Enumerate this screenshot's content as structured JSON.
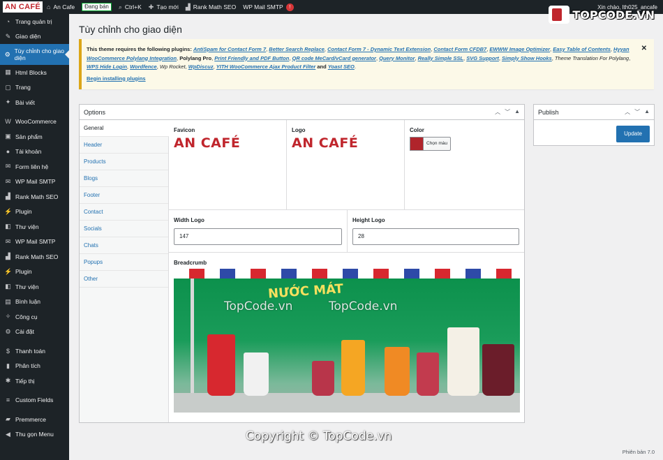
{
  "adminbar": {
    "logo": "AN CAFÉ",
    "site": "An Cafe",
    "status_badge": "Đang bán",
    "search_shortcut": "Ctrl+K",
    "new_label": "Tạo mới",
    "rank_math": "Rank Math SEO",
    "wp_mail": "WP Mail SMTP",
    "mail_count": "!",
    "greeting": "Xin chào, lth025_ancafe"
  },
  "sidebar": {
    "items": [
      {
        "label": "Trang quản trị",
        "icon": "dashboard-icon"
      },
      {
        "label": "Giao diện",
        "icon": "brush-icon"
      },
      {
        "label": "Tùy chỉnh cho giao diện",
        "icon": "settings-icon"
      },
      {
        "label": "Html Blocks",
        "icon": "block-icon"
      },
      {
        "label": "Trang",
        "icon": "page-icon"
      },
      {
        "label": "Bài viết",
        "icon": "pin-icon"
      },
      {
        "label": "WooCommerce",
        "icon": "woo-icon"
      },
      {
        "label": "Sản phẩm",
        "icon": "product-icon"
      },
      {
        "label": "Tài khoản",
        "icon": "user-icon"
      },
      {
        "label": "Form liên hệ",
        "icon": "mail-icon"
      },
      {
        "label": "WP Mail SMTP",
        "icon": "smtp-icon"
      },
      {
        "label": "Rank Math SEO",
        "icon": "chart-icon"
      },
      {
        "label": "Plugin",
        "icon": "plugin-icon"
      },
      {
        "label": "Thư viện",
        "icon": "media-icon"
      },
      {
        "label": "WP Mail SMTP",
        "icon": "smtp-icon"
      },
      {
        "label": "Rank Math SEO",
        "icon": "chart-icon"
      },
      {
        "label": "Plugin",
        "icon": "plugin-icon"
      },
      {
        "label": "Thư viện",
        "icon": "media-icon"
      },
      {
        "label": "Bình luận",
        "icon": "comment-icon"
      },
      {
        "label": "Công cụ",
        "icon": "tools-icon"
      },
      {
        "label": "Cài đặt",
        "icon": "settings-icon"
      },
      {
        "label": "Thanh toán",
        "icon": "payment-icon"
      },
      {
        "label": "Phân tích",
        "icon": "analytics-icon"
      },
      {
        "label": "Tiếp thị",
        "icon": "marketing-icon"
      },
      {
        "label": "Custom Fields",
        "icon": "fields-icon"
      },
      {
        "label": "Premmerce",
        "icon": "premmerce-icon"
      },
      {
        "label": "Thu gọn Menu",
        "icon": "collapse-icon"
      }
    ]
  },
  "page": {
    "title": "Tùy chỉnh cho giao diện",
    "notice": {
      "intro": "This theme requires the following plugins:",
      "plugins_linked": [
        "AntiSpam for Contact Form 7",
        "Better Search Replace",
        "Contact Form 7 - Dynamic Text Extension",
        "Contact Form CFDB7",
        "EWWW Image Optimizer",
        "Easy Table of Contents",
        "Hyyan WooCommerce Polylang Integration"
      ],
      "polylang": "Polylang Pro",
      "plugins_linked_2": [
        "Print Friendly and PDF Button",
        "QR code MeCard/vCard generator",
        "Query Monitor",
        "Really Simple SSL",
        "SVG Support",
        "Simply Show Hooks"
      ],
      "theme_translation": "Theme Translation For Polylang",
      "wps_hide": "WPS Hide Login",
      "wordfence": "Wordfence",
      "wp_rocket": "Wp Rocket",
      "wpdiscuz": "WpDiscuz",
      "yith": "YITH WooCommerce Ajax Product Filter",
      "and": "and",
      "yoast": "Yoast SEO",
      "install_link": "Begin installing plugins"
    }
  },
  "options": {
    "title": "Options",
    "tabs": [
      "General",
      "Header",
      "Products",
      "Blogs",
      "Footer",
      "Contact",
      "Socials",
      "Chats",
      "Popups",
      "Other"
    ],
    "favicon_label": "Favicon",
    "logo_label": "Logo",
    "color_label": "Color",
    "favicon_text": "AN CAFÉ",
    "logo_text": "AN CAFÉ",
    "color_value": "#b0242b",
    "pick_color": "Chọn màu",
    "width_label": "Width Logo",
    "width_value": "147",
    "height_label": "Height Logo",
    "height_value": "28",
    "breadcrumb_label": "Breadcrumb",
    "hero_title": "NƯỚC MÁT"
  },
  "publish": {
    "title": "Publish",
    "update": "Update"
  },
  "watermark": {
    "brand": "TOPCODE.VN",
    "center": "TopCode.vn",
    "copyright": "Copyright © TopCode.vn"
  },
  "footer": {
    "version": "Phiên bản 7.0"
  }
}
